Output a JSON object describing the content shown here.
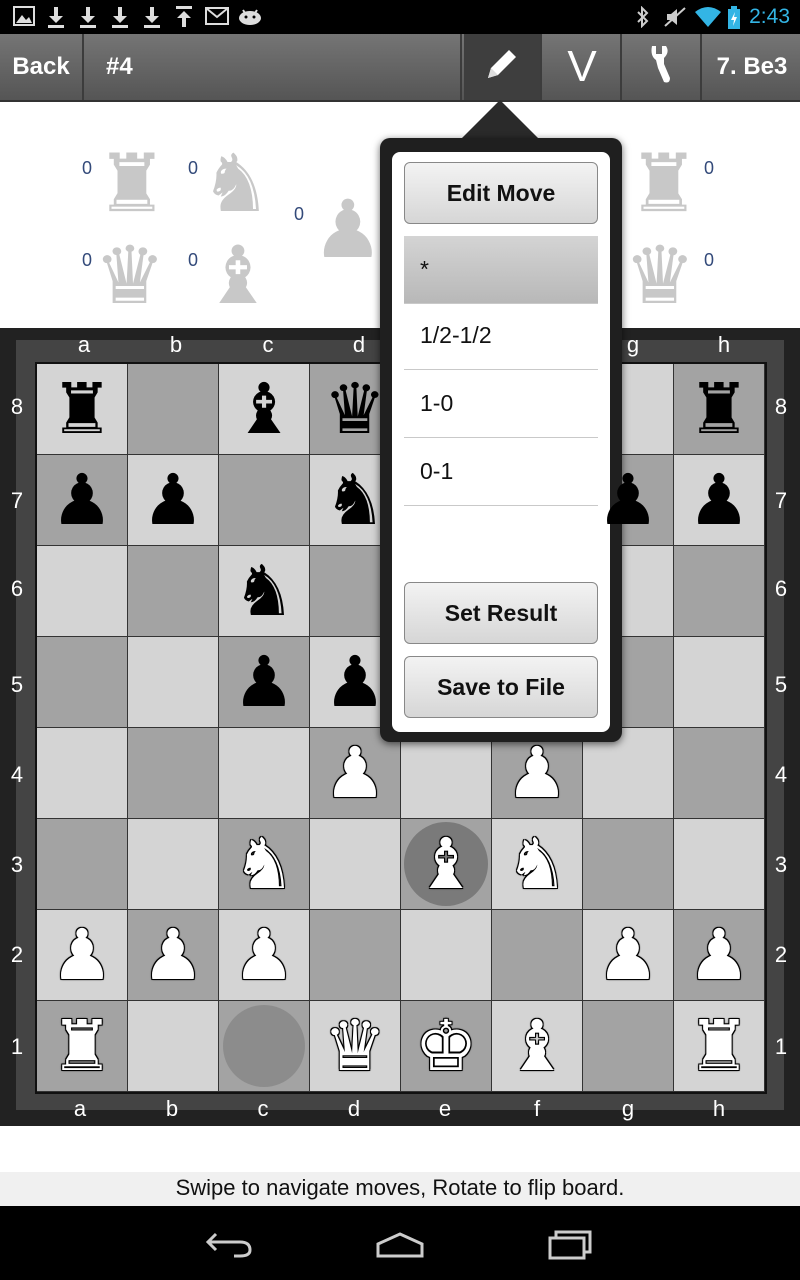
{
  "status_bar": {
    "notification_icons": [
      "image-icon",
      "download-icon",
      "download-icon",
      "download-icon",
      "download-icon",
      "upload-icon",
      "mail-icon",
      "android-icon"
    ],
    "system_icons": [
      "bluetooth-icon",
      "mute-icon",
      "wifi-icon",
      "battery-icon"
    ],
    "time": "2:43"
  },
  "action_bar": {
    "back_label": "Back",
    "title": "#4",
    "edit_icon": "pencil-icon",
    "v_label": "V",
    "tools_icon": "wrench-icon",
    "move_label": "7. Be3"
  },
  "captured": {
    "black_side": [
      {
        "piece": "rook",
        "count": "0"
      },
      {
        "piece": "knight",
        "count": "0"
      },
      {
        "piece": "pawn",
        "count": "0"
      },
      {
        "piece": "queen",
        "count": "0"
      },
      {
        "piece": "bishop",
        "count": "0"
      }
    ],
    "white_side": [
      {
        "piece": "rook",
        "count": "0"
      },
      {
        "piece": "queen",
        "count": "0"
      }
    ]
  },
  "board": {
    "files": [
      "a",
      "b",
      "c",
      "d",
      "e",
      "f",
      "g",
      "h"
    ],
    "ranks": [
      "8",
      "7",
      "6",
      "5",
      "4",
      "3",
      "2",
      "1"
    ],
    "position": [
      [
        "r",
        "",
        "b",
        "q",
        "",
        "",
        "",
        "r"
      ],
      [
        "p",
        "p",
        "",
        "n",
        "",
        "",
        "p",
        "p"
      ],
      [
        "",
        "",
        "n",
        "",
        "",
        "",
        "",
        ""
      ],
      [
        "",
        "",
        "p",
        "p",
        "",
        "",
        "",
        ""
      ],
      [
        "",
        "",
        "",
        "P",
        "",
        "P",
        "",
        ""
      ],
      [
        "",
        "",
        "N",
        "",
        "B",
        "N",
        "",
        ""
      ],
      [
        "P",
        "P",
        "P",
        "",
        "",
        "",
        "P",
        "P"
      ],
      [
        "R",
        "",
        "",
        "Q",
        "K",
        "B",
        "",
        "R"
      ]
    ],
    "last_move_from": "c1",
    "last_move_to": "e3"
  },
  "popup_menu": {
    "edit_move_label": "Edit Move",
    "result_options": [
      "*",
      "1/2-1/2",
      "1-0",
      "0-1"
    ],
    "selected_result": "*",
    "set_result_label": "Set Result",
    "save_label": "Save to File"
  },
  "hint": "Swipe to navigate moves, Rotate to flip board.",
  "nav_bar": {
    "icons": [
      "back-icon",
      "home-icon",
      "recent-apps-icon"
    ]
  }
}
